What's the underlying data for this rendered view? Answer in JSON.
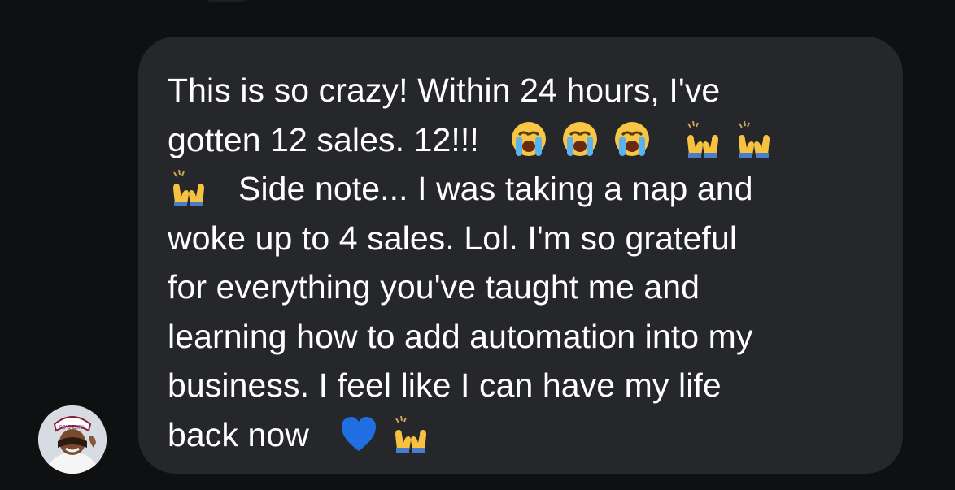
{
  "conversation": {
    "message": {
      "lines": [
        {
          "text_before": "This is so crazy! Within 24 hours, I've"
        },
        {
          "text_before": "gotten 12 sales. 12!!!",
          "emojis": [
            "loudly-crying-face",
            "loudly-crying-face",
            "loudly-crying-face",
            "raising-hands",
            "raising-hands"
          ]
        },
        {
          "emojis_before": [
            "raising-hands"
          ],
          "text_after": "Side note... I was taking a nap and"
        },
        {
          "text_before": "woke up to 4 sales. Lol. I'm so grateful"
        },
        {
          "text_before": "for everything you've taught me and"
        },
        {
          "text_before": "learning how to add automation into my"
        },
        {
          "text_before": "business. I feel like I can have my life"
        },
        {
          "text_before": "back now",
          "emojis": [
            "blue-heart",
            "raising-hands"
          ]
        }
      ]
    },
    "sender": {
      "avatar_icon": "profile-photo",
      "cap_text": "90'S GIRL"
    },
    "colors": {
      "background": "#0f1012",
      "bubble": "#26272b",
      "text": "#ffffff"
    }
  }
}
